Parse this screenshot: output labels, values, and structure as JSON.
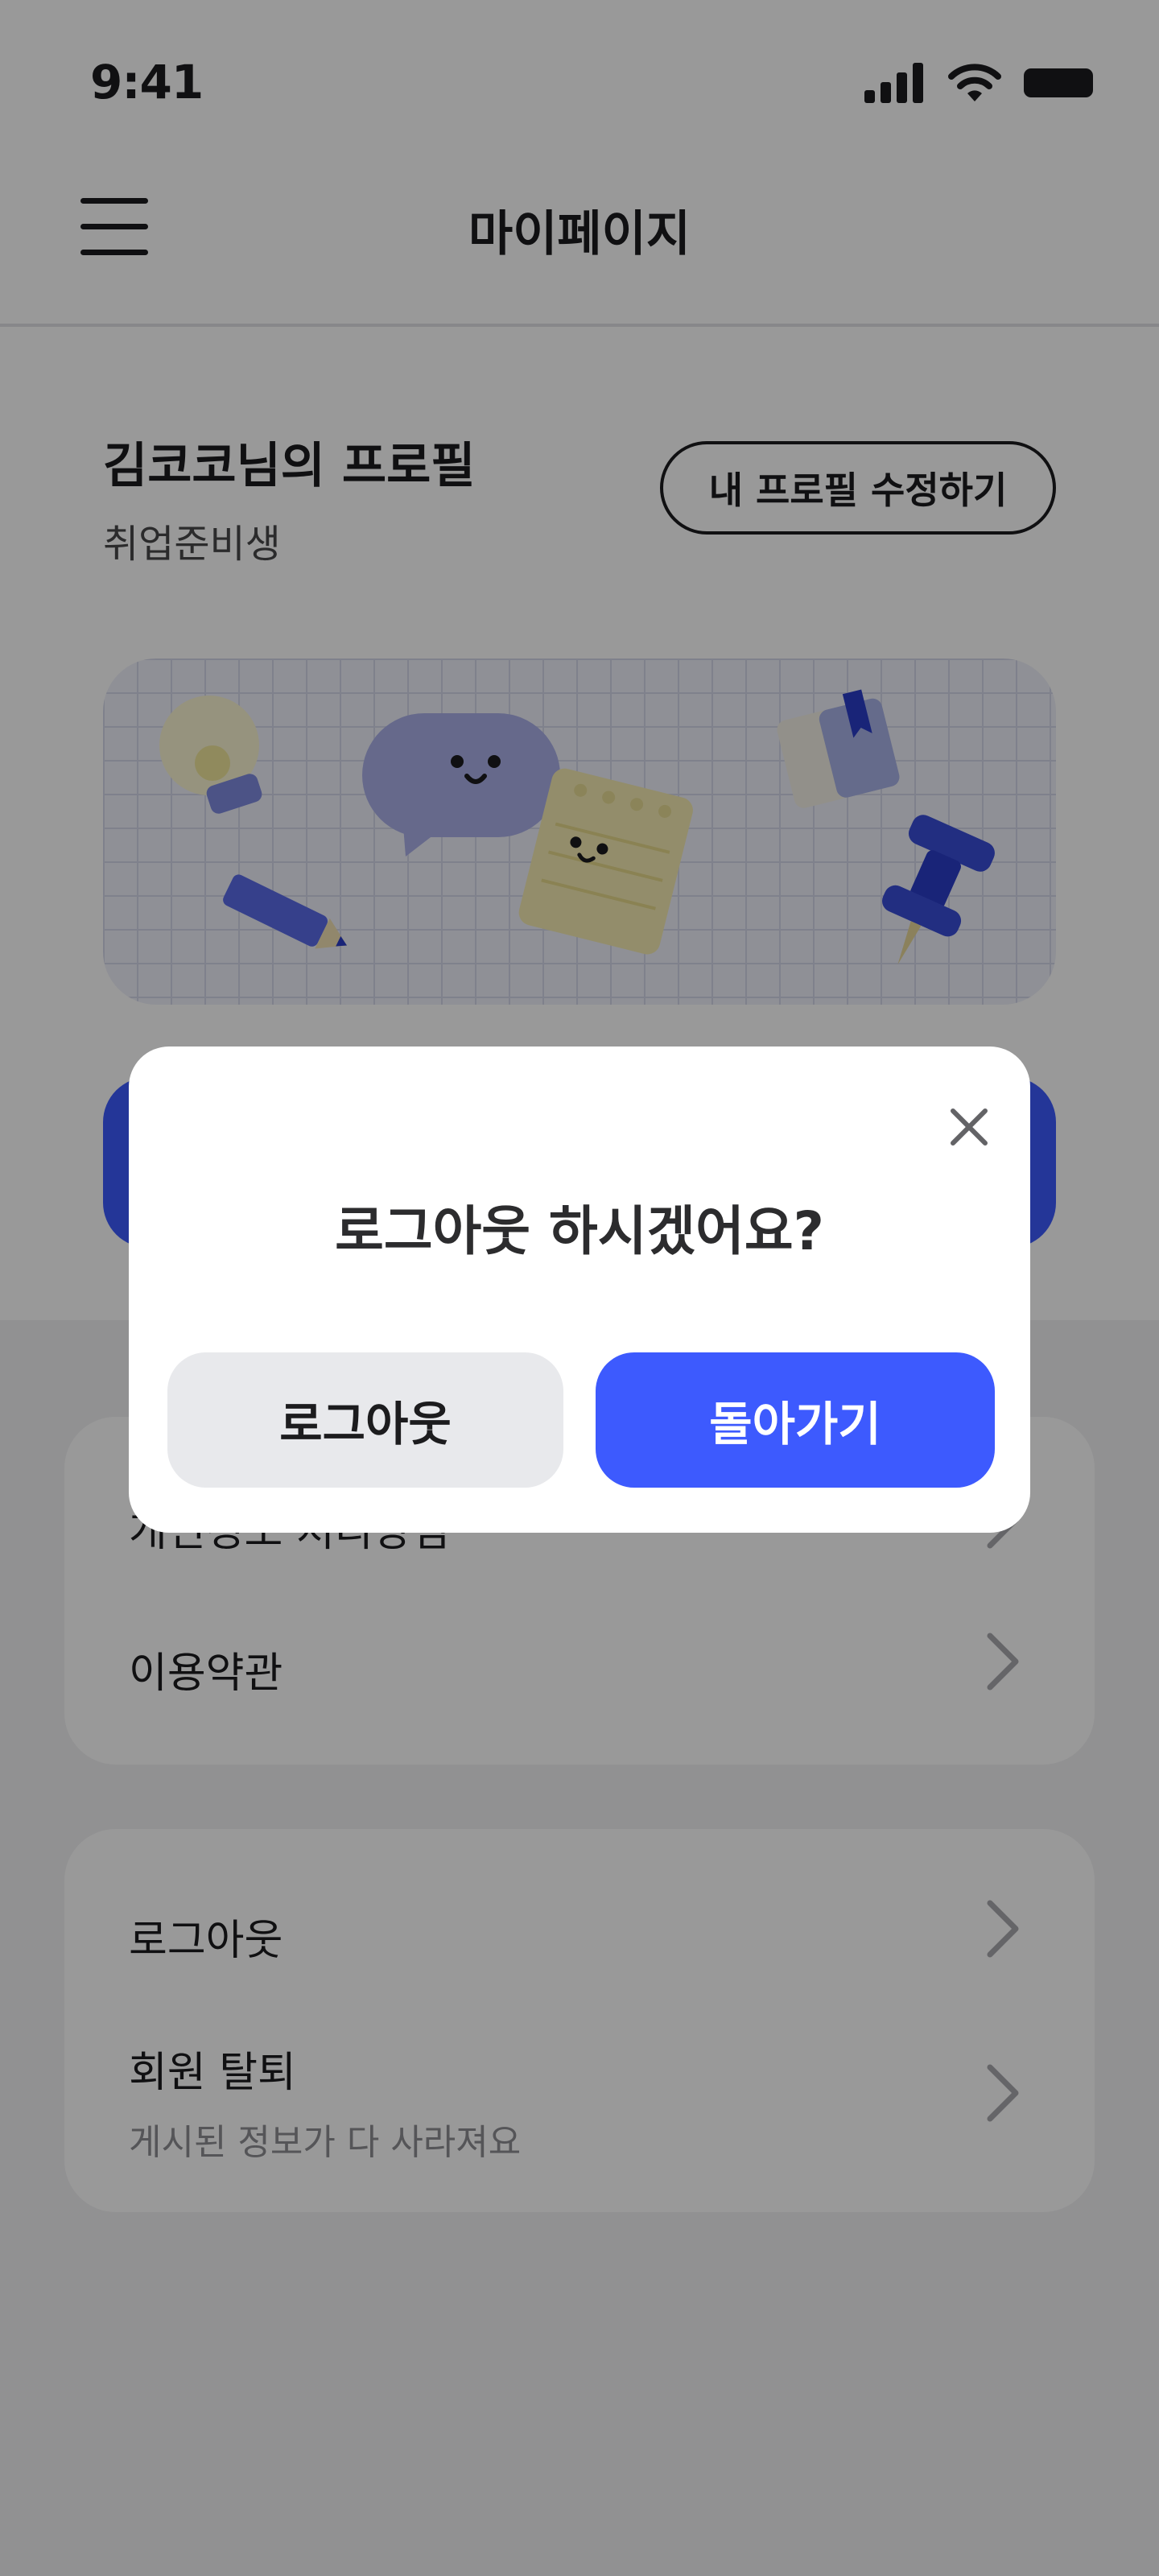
{
  "status_bar": {
    "time": "9:41"
  },
  "header": {
    "title": "마이페이지"
  },
  "profile": {
    "name": "김코코님의 프로필",
    "status": "취업준비생",
    "edit_label": "내 프로필 수정하기"
  },
  "menu_group_1": [
    {
      "label": "개인정보 처리방침"
    },
    {
      "label": "이용약관"
    }
  ],
  "menu_group_2": [
    {
      "label": "로그아웃"
    },
    {
      "label": "회원 탈퇴",
      "sub": "게시된 정보가 다 사라져요"
    }
  ],
  "dialog": {
    "title": "로그아웃 하시겠어요?",
    "logout_label": "로그아웃",
    "back_label": "돌아가기"
  },
  "colors": {
    "accent": "#3d5afe",
    "overlay": "rgba(0,0,0,0.40)",
    "secondary_button": "#e8e9ec"
  },
  "icons": [
    "signal-icon",
    "wifi-icon",
    "battery-icon",
    "hamburger-menu-icon",
    "close-icon",
    "chevron-right-icon"
  ]
}
